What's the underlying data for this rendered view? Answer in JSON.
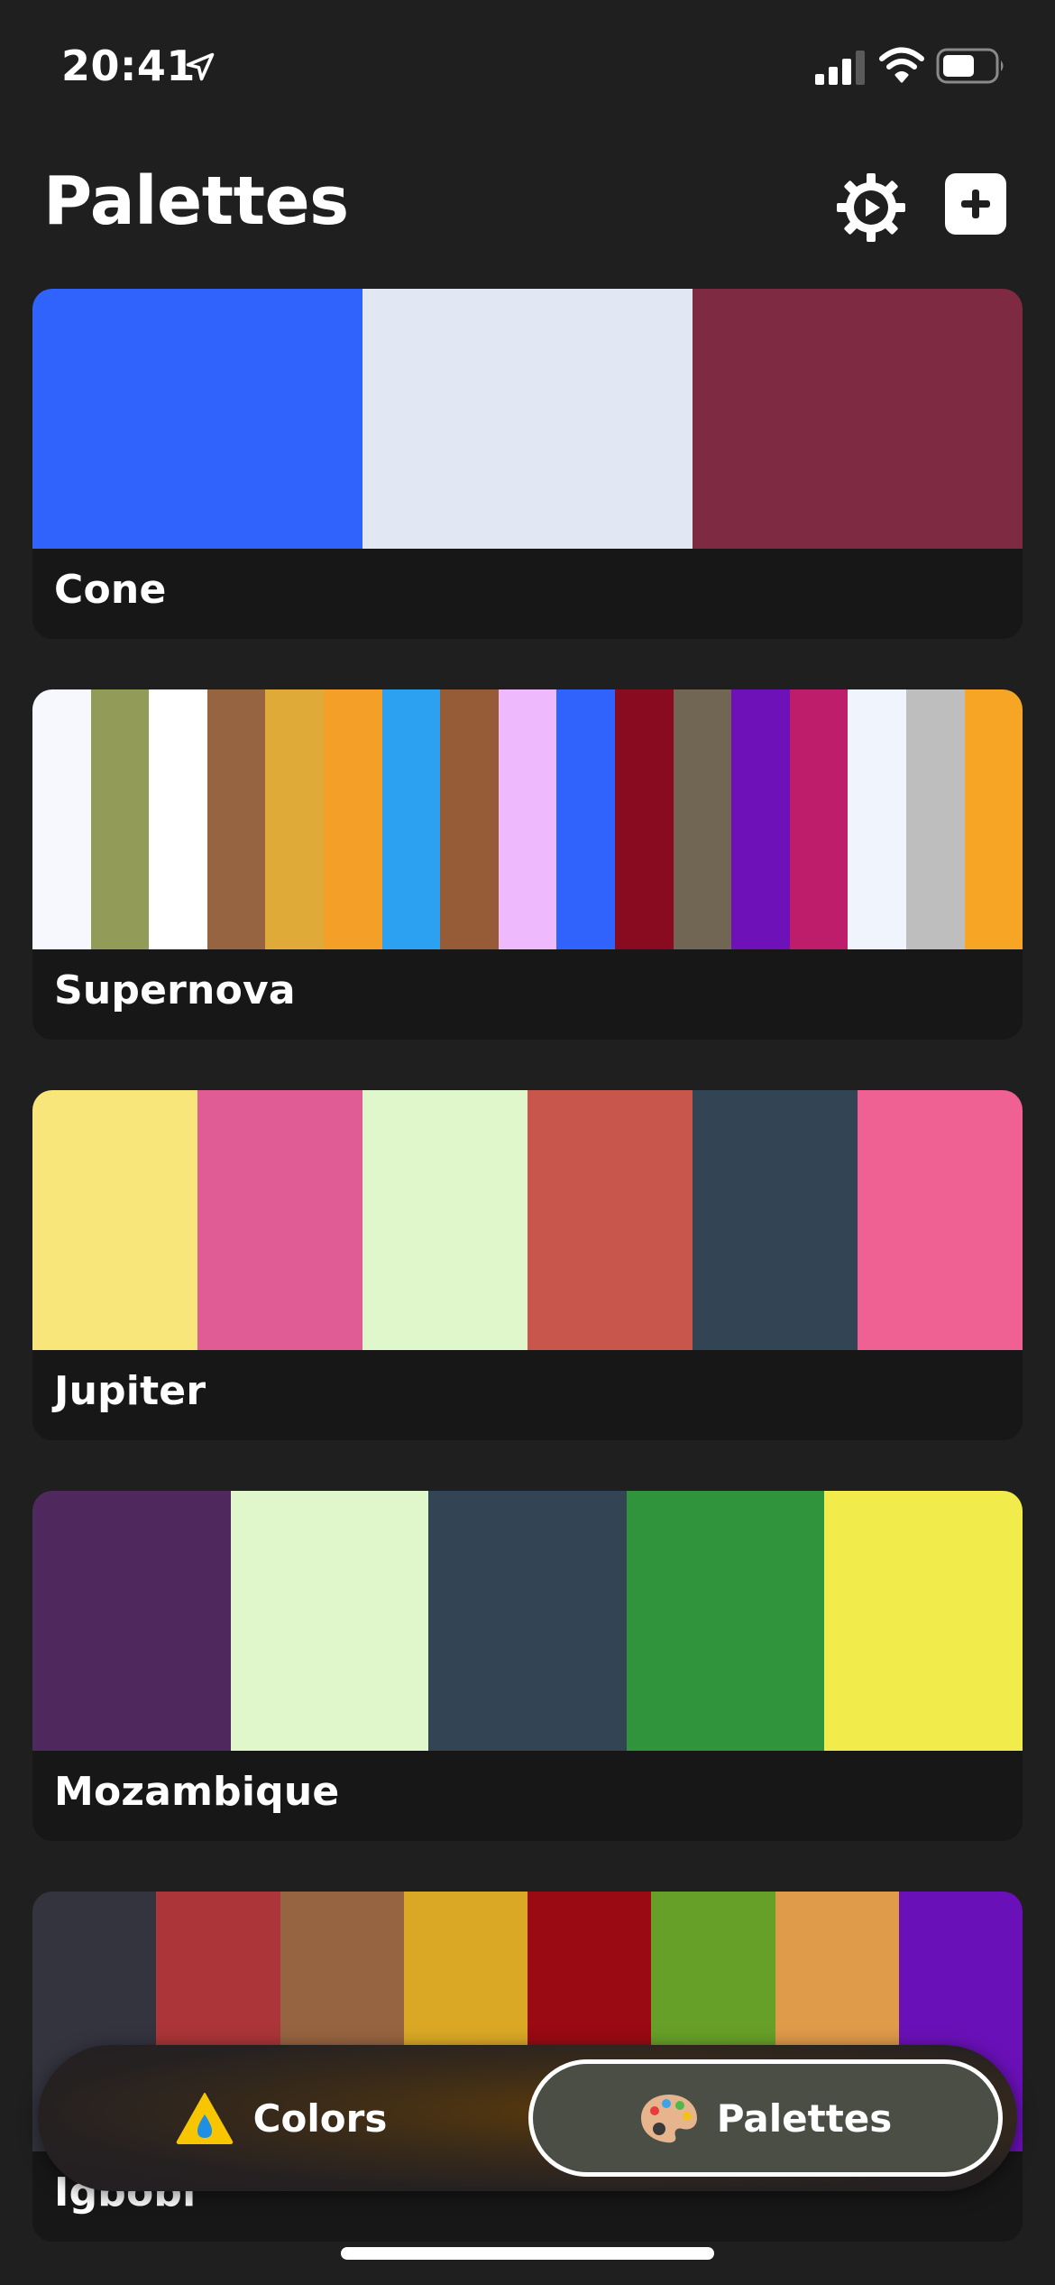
{
  "status_bar": {
    "time": "20:41"
  },
  "header": {
    "title": "Palettes"
  },
  "palettes": [
    {
      "name": "Cone",
      "colors": [
        "#2f63fb",
        "#e1e8f3",
        "#7e2a43"
      ]
    },
    {
      "name": "Supernova",
      "colors": [
        "#f7f8fd",
        "#929b58",
        "#ffffff",
        "#966441",
        "#e0aa39",
        "#f49f27",
        "#2ca1f1",
        "#965c38",
        "#efbafd",
        "#2f63fb",
        "#880b20",
        "#716653",
        "#6f11b8",
        "#bd1d6a",
        "#eff4fd",
        "#bebebe",
        "#f6a524"
      ]
    },
    {
      "name": "Jupiter",
      "colors": [
        "#f9e67b",
        "#e05c94",
        "#e0f7cb",
        "#c8564d",
        "#334455",
        "#ef6093"
      ]
    },
    {
      "name": "Mozambique",
      "colors": [
        "#4f295e",
        "#e0f7cb",
        "#334455",
        "#2f943c",
        "#f1ec4c"
      ]
    },
    {
      "name": "Igbobi",
      "colors": [
        "#34343f",
        "#ab3538",
        "#966441",
        "#daa825",
        "#990a13",
        "#67a029",
        "#df9a4a",
        "#6a10b8"
      ]
    }
  ],
  "tab_bar": {
    "colors_label": "Colors",
    "palettes_label": "Palettes",
    "active_tab": "Palettes"
  },
  "icons": {
    "location": "location-arrow-icon",
    "signal": "cellular-signal-icon",
    "wifi": "wifi-icon",
    "battery": "battery-icon",
    "settings": "gear-icon",
    "add": "plus-icon",
    "colors_tab": "drop-icon",
    "palettes_tab": "artist-palette-icon"
  }
}
